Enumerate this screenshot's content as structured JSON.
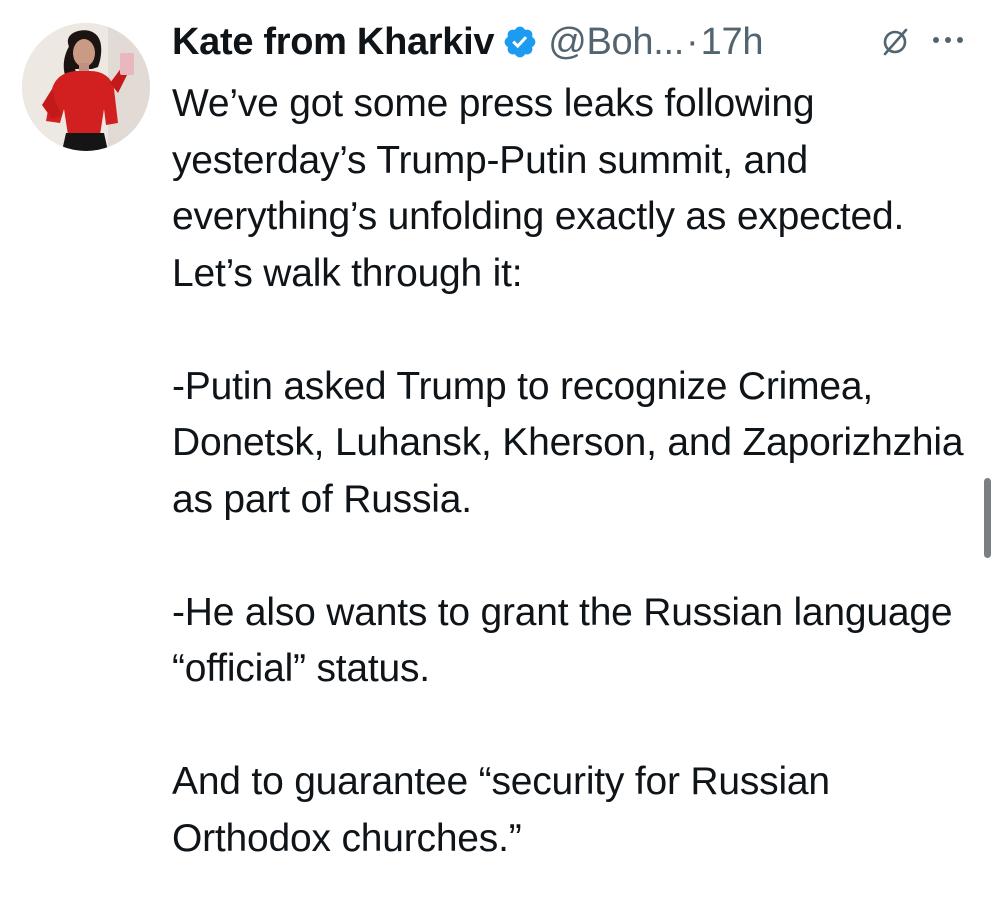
{
  "tweet": {
    "author": {
      "display_name": "Kate from Kharkiv",
      "handle": "@Boh...",
      "verified_icon": "verified-badge-icon",
      "avatar_icon": "avatar"
    },
    "separator": "·",
    "timestamp": "17h",
    "header_icons": [
      "grok-icon",
      "more-options-icon"
    ],
    "body": {
      "intro": "We’ve got some press leaks following yesterday’s Trump-Putin summit, and everything’s unfolding exactly as expected. Let’s walk through it:",
      "point_1": "-Putin asked Trump to recognize Crimea, Donetsk, Luhansk, Kherson, and Zaporizhzhia as part of Russia.",
      "point_2": "-He also wants to grant the Russian language “official” status.",
      "point_3": "And to guarantee “security for Russian Orthodox churches.”"
    }
  },
  "colors": {
    "text_primary": "#0f1419",
    "text_secondary": "#536471",
    "verified_blue": "#1d9bf0",
    "background": "#ffffff"
  }
}
